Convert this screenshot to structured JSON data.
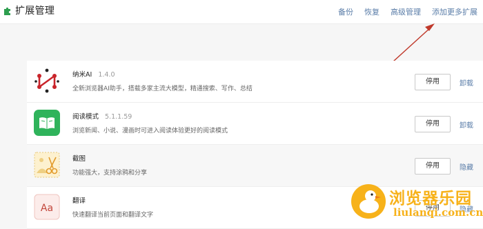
{
  "header": {
    "title": "扩展管理",
    "nav": [
      "备份",
      "恢复",
      "高级管理",
      "添加更多扩展"
    ]
  },
  "extensions": [
    {
      "name": "纳米AI",
      "version": "1.4.0",
      "desc": "全新浏览器AI助手，搭载多家主流大模型，精通搜索、写作、总结",
      "primary": "停用",
      "secondary": "卸载",
      "icon": "nami-ai-icon"
    },
    {
      "name": "阅读模式",
      "version": "5.1.1.59",
      "desc": "浏览新闻、小说、漫画时可进入阅读体验更好的阅读模式",
      "primary": "停用",
      "secondary": "卸载",
      "icon": "book-icon"
    },
    {
      "name": "截图",
      "version": "",
      "desc": "功能强大，支持涂鸦和分享",
      "primary": "停用",
      "secondary": "隐藏",
      "icon": "scissors-icon"
    },
    {
      "name": "翻译",
      "version": "",
      "desc": "快速翻译当前页面和翻译文字",
      "primary": "停用",
      "secondary": "隐藏",
      "icon": "translate-icon",
      "icon_text": "Aa"
    }
  ],
  "watermark": {
    "cn": "浏览器乐园",
    "en": "liulanqi.com.cn"
  },
  "colors": {
    "accent": "#5a7da8",
    "arrow": "#c0392b",
    "book_green": "#2fb35b",
    "watermark": "#f7b21a"
  }
}
